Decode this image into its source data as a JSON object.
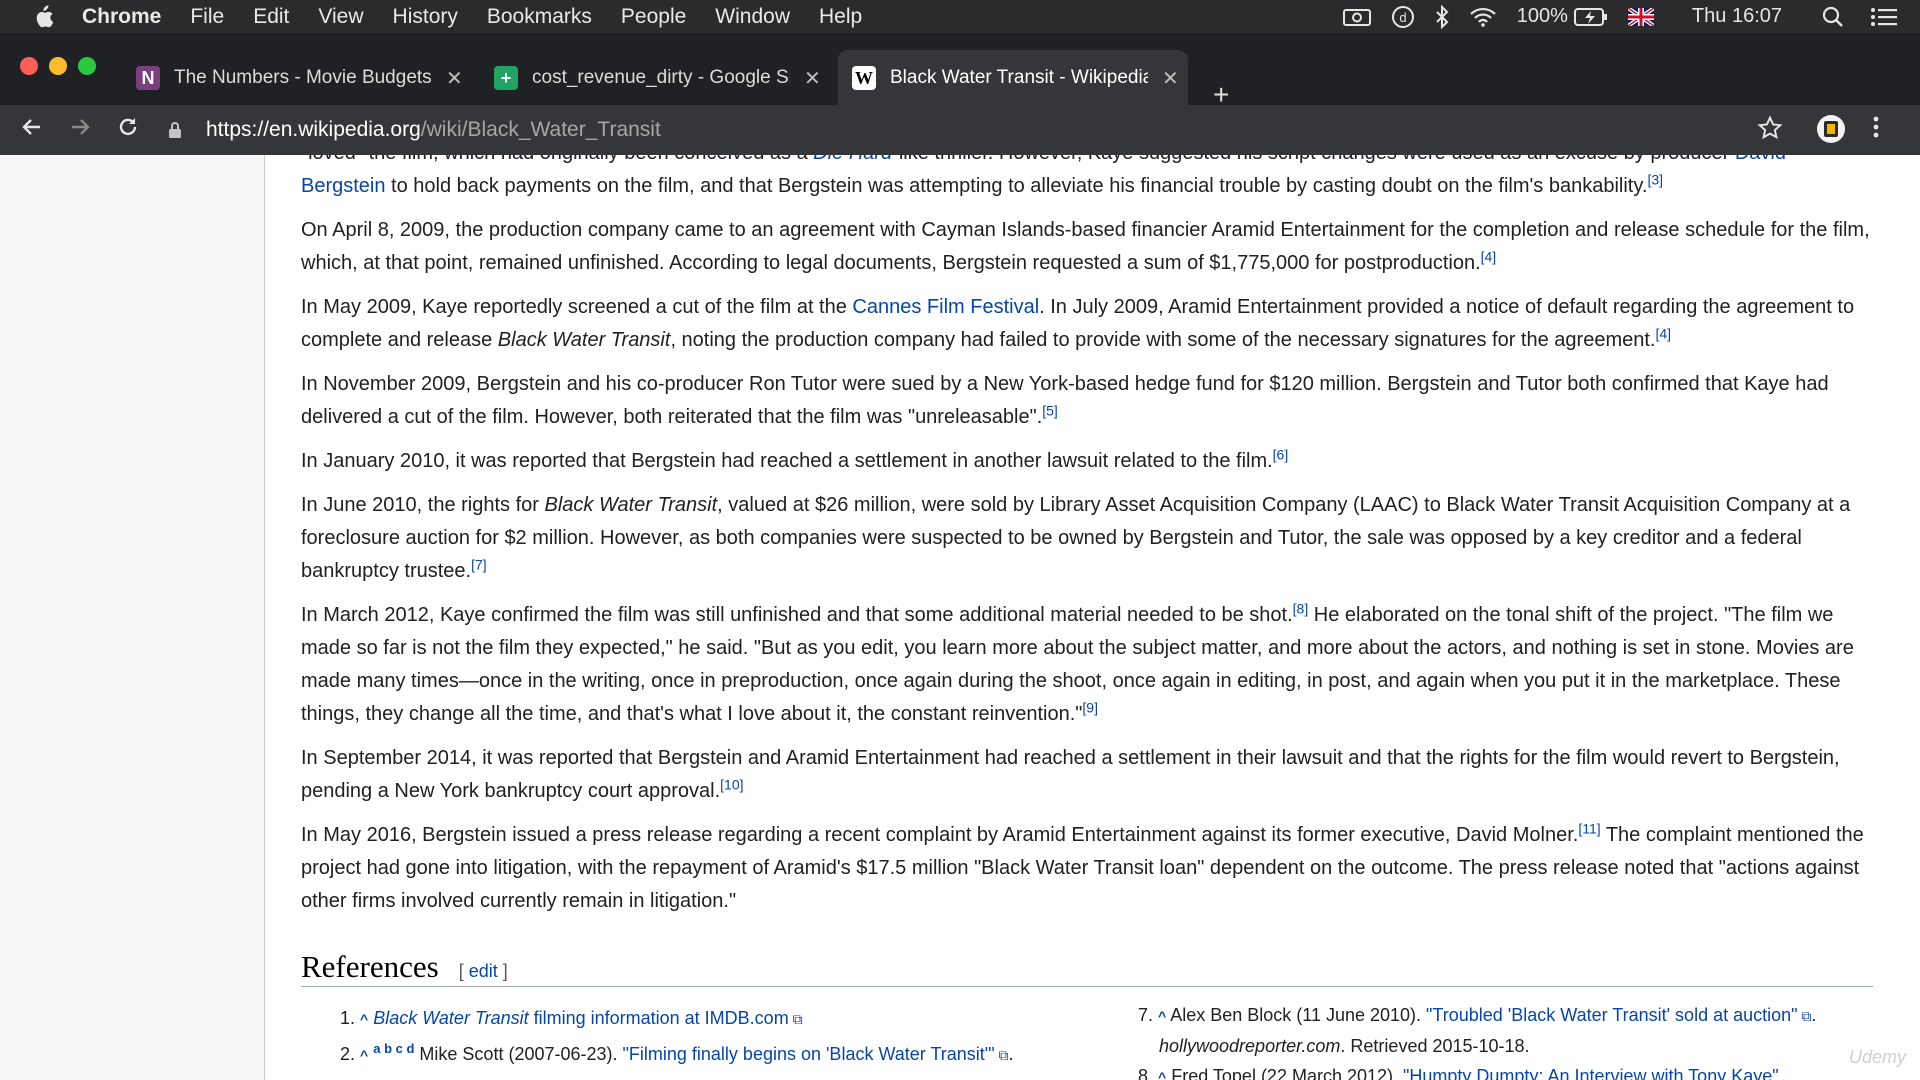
{
  "menubar": {
    "items": [
      "Chrome",
      "File",
      "Edit",
      "View",
      "History",
      "Bookmarks",
      "People",
      "Window",
      "Help"
    ],
    "battery": "100%",
    "clock": "Thu 16:07"
  },
  "tabs": [
    {
      "title": "The Numbers - Movie Budgets",
      "favicon": "N"
    },
    {
      "title": "cost_revenue_dirty - Google Sheets",
      "favicon": "+"
    },
    {
      "title": "Black Water Transit - Wikipedia",
      "favicon": "W"
    }
  ],
  "omnibox": {
    "host": "https://en.wikipedia.org",
    "path": "/wiki/Black_Water_Transit"
  },
  "article": {
    "p0": {
      "a": "\"loved\" the film, which had originally been conceived as a ",
      "link1": "Die Hard",
      "b": "-like thriller. However, Kaye suggested his script changes were used as an excuse by producer ",
      "link2": "David Bergstein",
      "c": " to hold back payments on the film, and that Bergstein was attempting to alleviate his financial trouble by casting doubt on the film's bankability.",
      "ref": "[3]"
    },
    "p1": {
      "text": "On April 8, 2009, the production company came to an agreement with Cayman Islands-based financier Aramid Entertainment for the completion and release schedule for the film, which, at that point, remained unfinished. According to legal documents, Bergstein requested a sum of $1,775,000 for postproduction.",
      "ref": "[4]"
    },
    "p2": {
      "a": "In May 2009, Kaye reportedly screened a cut of the film at the ",
      "link": "Cannes Film Festival",
      "b": ". In July 2009, Aramid Entertainment provided a notice of default regarding the agreement to complete and release ",
      "italic": "Black Water Transit",
      "c": ", noting the production company had failed to provide with some of the necessary signatures for the agreement.",
      "ref": "[4]"
    },
    "p3": {
      "text": "In November 2009, Bergstein and his co-producer Ron Tutor were sued by a New York-based hedge fund for $120 million. Bergstein and Tutor both confirmed that Kaye had delivered a cut of the film. However, both reiterated that the film was \"unreleasable\".",
      "ref": "[5]"
    },
    "p4": {
      "text": "In January 2010, it was reported that Bergstein had reached a settlement in another lawsuit related to the film.",
      "ref": "[6]"
    },
    "p5": {
      "a": "In June 2010, the rights for ",
      "italic": "Black Water Transit",
      "b": ", valued at $26 million, were sold by Library Asset Acquisition Company (LAAC) to Black Water Transit Acquisition Company at a foreclosure auction for $2 million. However, as both companies were suspected to be owned by Bergstein and Tutor, the sale was opposed by a key creditor and a federal bankruptcy trustee.",
      "ref": "[7]"
    },
    "p6": {
      "a": "In March 2012, Kaye confirmed the film was still unfinished and that some additional material needed to be shot.",
      "ref1": "[8]",
      "b": " He elaborated on the tonal shift of the project. \"The film we made so far is not the film they expected,\" he said. \"But as you edit, you learn more about the subject matter, and more about the actors, and nothing is set in stone. Movies are made many times—once in the writing, once in preproduction, once again during the shoot, once again in editing, in post, and again when you put it in the marketplace. These things, they change all the time, and that's what I love about it, the constant reinvention.\"",
      "ref2": "[9]"
    },
    "p7": {
      "text": "In September 2014, it was reported that Bergstein and Aramid Entertainment had reached a settlement in their lawsuit and that the rights for the film would revert to Bergstein, pending a New York bankruptcy court approval.",
      "ref": "[10]"
    },
    "p8": {
      "a": "In May 2016, Bergstein issued a press release regarding a recent complaint by Aramid Entertainment against its former executive, David Molner.",
      "ref": "[11]",
      "b": " The complaint mentioned the project had gone into litigation, with the repayment of Aramid's $17.5 million \"Black Water Transit loan\" dependent on the outcome. The press release noted that \"actions against other firms involved currently remain in litigation.\""
    }
  },
  "references": {
    "heading": "References",
    "edit_open": "[ ",
    "edit_label": "edit",
    "edit_close": " ]",
    "left": [
      {
        "num": "1.",
        "caret": "^",
        "link_italic": "Black Water Transit",
        "link": " filming information at IMDB.com"
      },
      {
        "num": "2.",
        "caret": "^",
        "letters": "a b c d",
        "text": " Mike Scott (2007-06-23). ",
        "link": "\"Filming finally begins on 'Black Water Transit'\"",
        "after": "."
      }
    ],
    "right": [
      {
        "num": "7.",
        "caret": "^",
        "text": " Alex Ben Block (11 June 2010). ",
        "link": "\"Troubled 'Black Water Transit' sold at auction\"",
        "after": ".",
        "line2_italic": "hollywoodreporter.com",
        "line2": ". Retrieved 2015-10-18."
      },
      {
        "num": "8.",
        "caret": "^",
        "text": " Fred Topel (22 March 2012). ",
        "link": "\"Humpty Dumpty: An Interview with Tony Kaye\""
      }
    ]
  },
  "watermark": "Udemy",
  "colors": {
    "link": "#0645ad",
    "text": "#202122",
    "chrome_dark": "#202124",
    "toolbar": "#35363a"
  },
  "icons": [
    "apple-icon",
    "camera-icon",
    "dictation-icon",
    "bluetooth-icon",
    "wifi-icon",
    "battery-icon",
    "flag-icon",
    "search-icon",
    "list-icon",
    "back-icon",
    "forward-icon",
    "reload-icon",
    "lock-icon",
    "star-icon",
    "extension-icon",
    "more-icon"
  ]
}
